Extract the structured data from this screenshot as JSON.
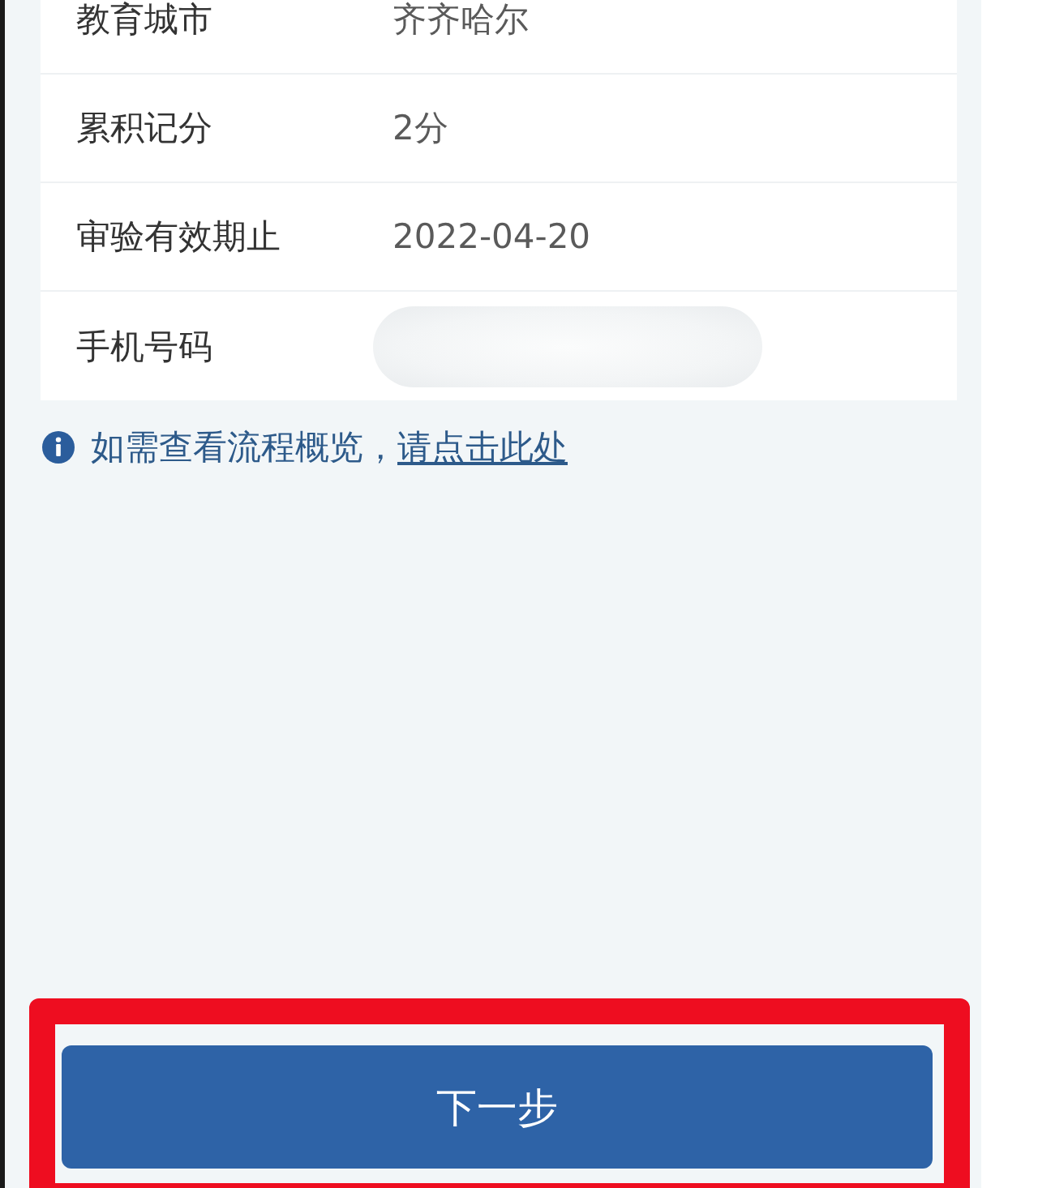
{
  "info_rows": [
    {
      "label": "教育城市",
      "value": "齐齐哈尔",
      "redacted": false
    },
    {
      "label": "累积记分",
      "value": "2分",
      "redacted": false
    },
    {
      "label": "审验有效期止",
      "value": "2022-04-20",
      "redacted": false
    },
    {
      "label": "手机号码",
      "redacted": true
    }
  ],
  "notice": {
    "text": "如需查看流程概览，",
    "link": "请点击此处"
  },
  "next_button": {
    "label": "下一步",
    "highlighted": true
  }
}
